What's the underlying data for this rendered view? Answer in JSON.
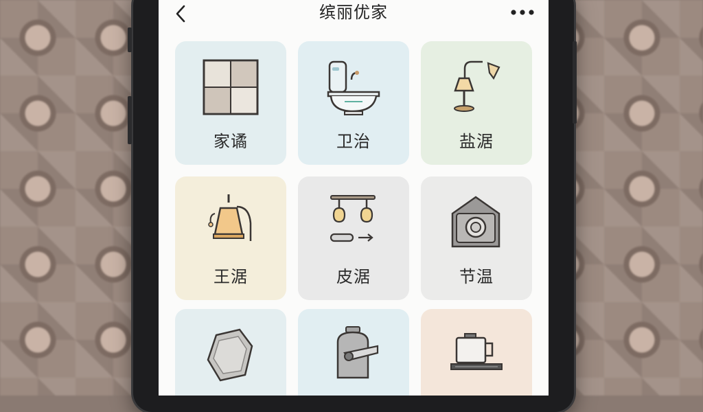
{
  "header": {
    "title": "缤丽优家",
    "back_icon": "chevron-left-icon",
    "more_icon": "ellipsis-icon"
  },
  "categories": [
    {
      "label": "家谲",
      "icon": "floor-tile-icon",
      "bg": "#e3eef0"
    },
    {
      "label": "卫治",
      "icon": "toilet-icon",
      "bg": "#e1eef2"
    },
    {
      "label": "盐涺",
      "icon": "lamp-icon",
      "bg": "#e6efe2"
    },
    {
      "label": "王涺",
      "icon": "pendant-lamp-icon",
      "bg": "#f4eedb"
    },
    {
      "label": "皮涺",
      "icon": "ceiling-light-icon",
      "bg": "#e9e9e9"
    },
    {
      "label": "节温",
      "icon": "heater-icon",
      "bg": "#ebebea"
    },
    {
      "label": "",
      "icon": "stone-icon",
      "bg": "#e4eef0"
    },
    {
      "label": "",
      "icon": "faucet-icon",
      "bg": "#e1eef2"
    },
    {
      "label": "",
      "icon": "stove-icon",
      "bg": "#f4e6da"
    }
  ]
}
